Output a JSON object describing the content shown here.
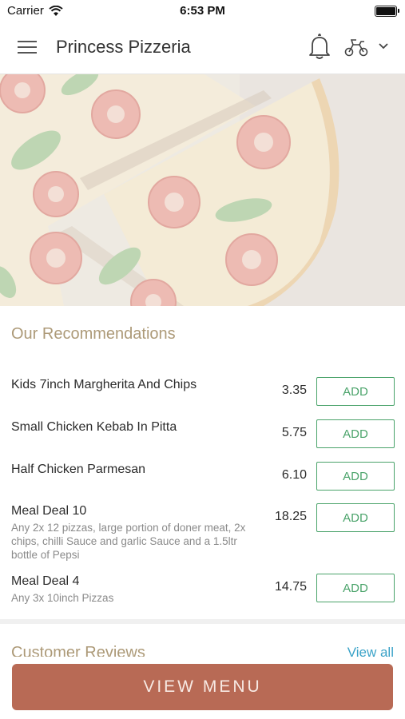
{
  "status_bar": {
    "carrier": "Carrier",
    "time": "6:53 PM"
  },
  "header": {
    "title": "Princess Pizzeria",
    "icons": [
      "menu-icon",
      "bell-icon",
      "delivery-scooter-icon",
      "chevron-down-icon"
    ]
  },
  "hero": {
    "image": "pizza-photo"
  },
  "recommendations": {
    "title": "Our Recommendations",
    "add_label": "ADD",
    "items": [
      {
        "name": "Kids 7inch Margherita And Chips",
        "price": "3.35",
        "description": ""
      },
      {
        "name": "Small Chicken Kebab In Pitta",
        "price": "5.75",
        "description": ""
      },
      {
        "name": "Half Chicken Parmesan",
        "price": "6.10",
        "description": ""
      },
      {
        "name": "Meal Deal 10",
        "price": "18.25",
        "description": "Any 2x 12 pizzas, large portion of doner meat, 2x chips, chilli Sauce and garlic Sauce and a 1.5ltr bottle of Pepsi"
      },
      {
        "name": "Meal Deal 4",
        "price": "14.75",
        "description": "Any 3x 10inch Pizzas"
      }
    ]
  },
  "reviews": {
    "title": "Customer Reviews",
    "view_all": "View all"
  },
  "footer": {
    "view_menu": "VIEW MENU"
  },
  "colors": {
    "accent_gold": "#ad9a78",
    "add_green": "#4aa36a",
    "button_terracotta": "#b86a55",
    "link_blue": "#3ba3c8"
  }
}
